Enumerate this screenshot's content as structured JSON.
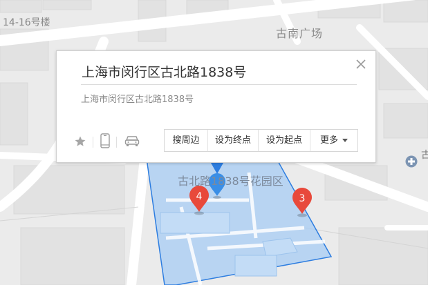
{
  "map": {
    "labels": {
      "building": "14-16号楼",
      "plaza": "古南广场",
      "area": "古北路1838号花园区",
      "edge": "古繁"
    },
    "markers": [
      {
        "number": "4",
        "color": "#e8493b"
      },
      {
        "number": "3",
        "color": "#e8493b"
      }
    ],
    "location_pin_color": "#3a8ee6",
    "area_fill_color": "#a9cdf3",
    "area_stroke_color": "#2d7de0"
  },
  "popup": {
    "title": "上海市闵行区古北路1838号",
    "address": "上海市闵行区古北路1838号",
    "actions": {
      "search_nearby": "搜周边",
      "set_destination": "设为终点",
      "set_origin": "设为起点",
      "more": "更多"
    }
  },
  "icons": {
    "close": "close-icon",
    "favorite": "star-icon",
    "phone": "phone-icon",
    "car": "car-icon",
    "poi": "hospital-icon"
  }
}
